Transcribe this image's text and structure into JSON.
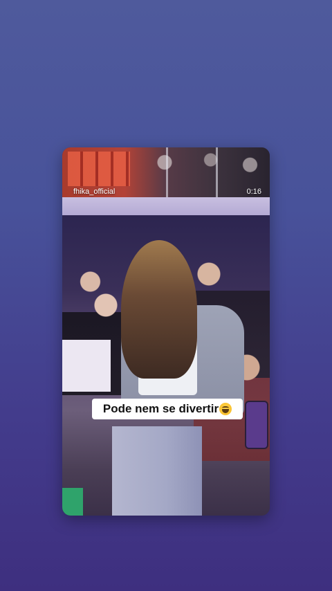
{
  "story": {
    "username": "fhika_official",
    "timestamp": "0:16",
    "caption": "Pode nem se divertir",
    "caption_emoji": "grinning-sweat-emoji"
  }
}
